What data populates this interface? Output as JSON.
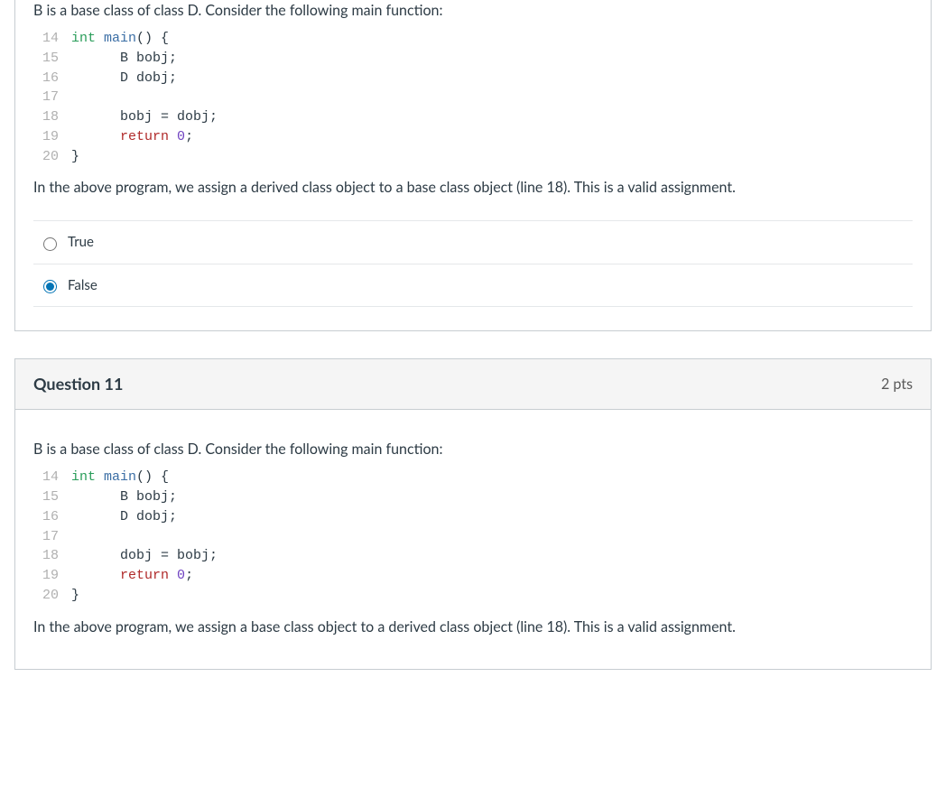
{
  "q10": {
    "intro": "B is a base class of class D. Consider the following main function:",
    "code": [
      {
        "n": "14",
        "segments": [
          {
            "t": "int ",
            "c": "kw-type"
          },
          {
            "t": "main",
            "c": "fn"
          },
          {
            "t": "() {",
            "c": ""
          }
        ]
      },
      {
        "n": "15",
        "segments": [
          {
            "t": "      B bobj;",
            "c": ""
          }
        ]
      },
      {
        "n": "16",
        "segments": [
          {
            "t": "      D dobj;",
            "c": ""
          }
        ]
      },
      {
        "n": "17",
        "segments": [
          {
            "t": "",
            "c": ""
          }
        ]
      },
      {
        "n": "18",
        "segments": [
          {
            "t": "      bobj = dobj;",
            "c": ""
          }
        ]
      },
      {
        "n": "19",
        "segments": [
          {
            "t": "      ",
            "c": ""
          },
          {
            "t": "return",
            "c": "kw-return"
          },
          {
            "t": " ",
            "c": ""
          },
          {
            "t": "0",
            "c": "num"
          },
          {
            "t": ";",
            "c": ""
          }
        ]
      },
      {
        "n": "20",
        "segments": [
          {
            "t": "}",
            "c": ""
          }
        ]
      }
    ],
    "after": "In the above program, we assign a derived class object to a base class object (line 18). This is a valid assignment.",
    "options": {
      "true": "True",
      "false": "False"
    },
    "selected": "false"
  },
  "q11": {
    "title": "Question 11",
    "pts": "2 pts",
    "intro": "B is a base class of class D. Consider the following main function:",
    "code": [
      {
        "n": "14",
        "segments": [
          {
            "t": "int ",
            "c": "kw-type"
          },
          {
            "t": "main",
            "c": "fn"
          },
          {
            "t": "() {",
            "c": ""
          }
        ]
      },
      {
        "n": "15",
        "segments": [
          {
            "t": "      B bobj;",
            "c": ""
          }
        ]
      },
      {
        "n": "16",
        "segments": [
          {
            "t": "      D dobj;",
            "c": ""
          }
        ]
      },
      {
        "n": "17",
        "segments": [
          {
            "t": "",
            "c": ""
          }
        ]
      },
      {
        "n": "18",
        "segments": [
          {
            "t": "      dobj = bobj;",
            "c": ""
          }
        ]
      },
      {
        "n": "19",
        "segments": [
          {
            "t": "      ",
            "c": ""
          },
          {
            "t": "return",
            "c": "kw-return"
          },
          {
            "t": " ",
            "c": ""
          },
          {
            "t": "0",
            "c": "num"
          },
          {
            "t": ";",
            "c": ""
          }
        ]
      },
      {
        "n": "20",
        "segments": [
          {
            "t": "}",
            "c": ""
          }
        ]
      }
    ],
    "after": "In the above program, we assign a base class object to a derived class object (line 18). This is a valid assignment."
  }
}
